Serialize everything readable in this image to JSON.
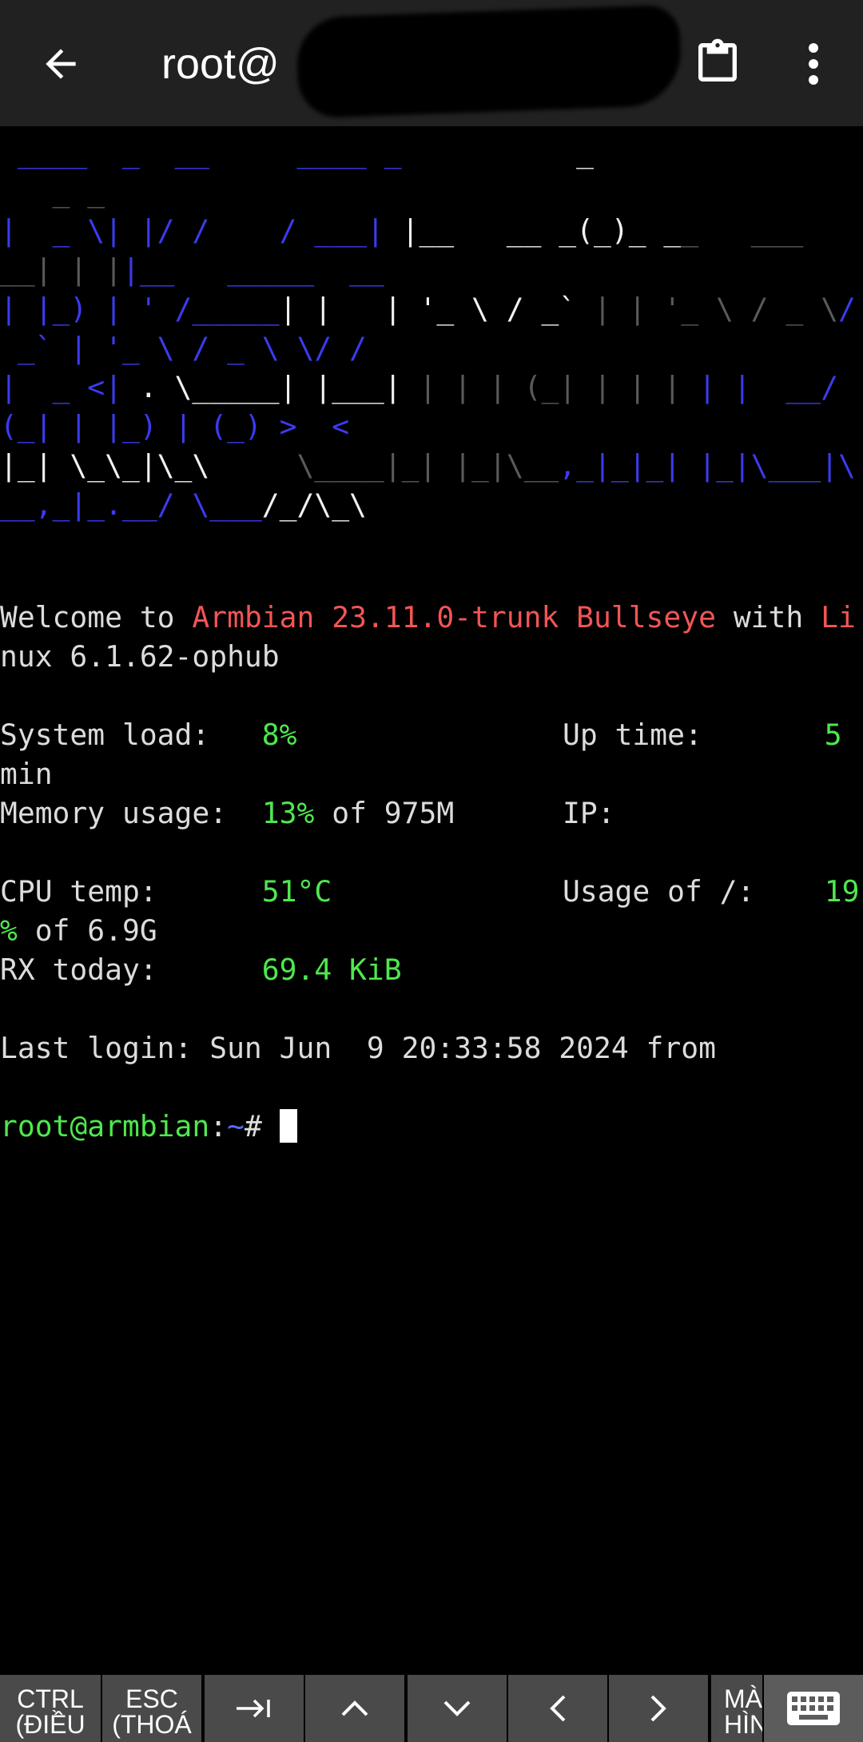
{
  "appbar": {
    "title": "root@",
    "back_icon": "arrow-left-icon",
    "clipboard_icon": "clipboard-icon",
    "menu_icon": "more-vert-icon"
  },
  "terminal": {
    "banner": [
      {
        "segs": [
          {
            "c": "blue",
            "t": " ____  _  __     ____ _          "
          },
          {
            "c": "white",
            "t": "_"
          }
        ]
      },
      {
        "segs": [
          {
            "c": "gray",
            "t": "   _ _"
          }
        ]
      },
      {
        "segs": [
          {
            "c": "blue",
            "t": "|  _ \\| |/ /    / ___| "
          },
          {
            "c": "white",
            "t": "|__   __ _(_)_ _"
          },
          {
            "c": "gray",
            "t": "_   ___"
          }
        ]
      },
      {
        "segs": [
          {
            "c": "gray",
            "t": "__| | |"
          },
          {
            "c": "blue",
            "t": "|__   _____  __"
          }
        ]
      },
      {
        "segs": [
          {
            "c": "blue",
            "t": "| |_) | ' /_____"
          },
          {
            "c": "white",
            "t": "| |   | '_ \\ / _`"
          },
          {
            "c": "gray",
            "t": " | | '_ \\ / _ \\"
          },
          {
            "c": "blue",
            "t": "/"
          }
        ]
      },
      {
        "segs": [
          {
            "c": "blue",
            "t": " _` | '_ \\ / _ \\ \\/ /"
          }
        ]
      },
      {
        "segs": [
          {
            "c": "blue",
            "t": "|  _ <| "
          },
          {
            "c": "white",
            "t": ". \\_____| |___|"
          },
          {
            "c": "gray",
            "t": " | | | (_| | | |"
          },
          {
            "c": "blue",
            "t": " | |  __/"
          }
        ]
      },
      {
        "segs": [
          {
            "c": "blue",
            "t": "(_| | |_) | (_) >  <"
          }
        ]
      },
      {
        "segs": [
          {
            "c": "white",
            "t": "|_| \\_\\_|\\_\\     "
          },
          {
            "c": "gray",
            "t": "\\____|_| |_|\\__"
          },
          {
            "c": "blue",
            "t": ",_|_|_| |_|\\___|\\"
          }
        ]
      },
      {
        "segs": [
          {
            "c": "blue",
            "t": "__,_|_.__/ \\___"
          },
          {
            "c": "white",
            "t": "/_/\\_\\"
          }
        ]
      }
    ],
    "welcome_prefix": "Welcome to ",
    "welcome_os": "Armbian 23.11.0-trunk Bullseye",
    "welcome_with": " with ",
    "welcome_kernel_a": "Li",
    "welcome_kernel_b": "nux 6.1.62-ophub",
    "sys_load_label": "System load:   ",
    "sys_load_value": "8%",
    "uptime_label": "Up time:       ",
    "uptime_value_a": "5",
    "uptime_value_b": "min",
    "mem_label": "Memory usage:  ",
    "mem_value": "13%",
    "mem_of": " of 975M",
    "ip_label": "IP:",
    "cpu_label": "CPU temp:      ",
    "cpu_value": "51°C",
    "usage_label": "Usage of /:    ",
    "usage_value_a": "19",
    "usage_value_b": "%",
    "usage_of": " of 6.9G",
    "rx_label": "RX today:      ",
    "rx_value": "69.4 KiB",
    "last_login": "Last login: Sun Jun  9 20:33:58 2024 from ",
    "prompt_user": "root@armbian",
    "prompt_colon": ":",
    "prompt_path": "~",
    "prompt_hash": "# "
  },
  "extra_keys": {
    "ctrl_line1": "CTRL",
    "ctrl_line2": "(ĐIỀU",
    "esc_line1": "ESC",
    "esc_line2": "(THOÁ",
    "tab_icon": "tab-arrow-icon",
    "up_icon": "chevron-up-icon",
    "down_icon": "chevron-down-icon",
    "left_icon": "chevron-left-icon",
    "right_icon": "chevron-right-icon",
    "ma_line1": "MÀ",
    "ma_line2": "HÌN",
    "keyboard_icon": "keyboard-icon"
  }
}
